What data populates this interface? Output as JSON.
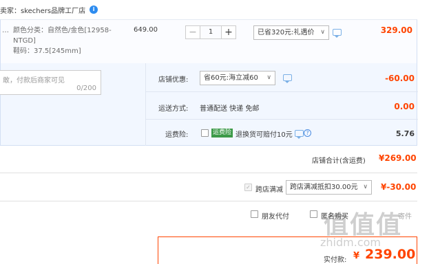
{
  "seller": {
    "label": "卖家：skechers品牌工厂店",
    "badge": "i"
  },
  "item": {
    "dots": "…",
    "sku_color": "颜色分类：自然色/金色[12958-NTGD]",
    "sku_size": "鞋码：37.5[245mm]",
    "unit_price": "649.00",
    "qty_minus": "−",
    "qty": "1",
    "qty_plus": "+",
    "promo_selected": "已省320元:礼遇价",
    "row_total": "329.00"
  },
  "memo": {
    "placeholder": "敢，付款后商家可见",
    "counter": "0/200"
  },
  "shop": {
    "discount_label": "店铺优惠:",
    "discount_selected": "省60元:海立减60",
    "discount_amount": "-60.00",
    "shipping_label": "运送方式:",
    "shipping_value": "普通配送 快递 免邮",
    "shipping_amount": "0.00",
    "insurance_label": "运费险:",
    "insurance_tag": "运费险",
    "insurance_desc": "退换货可赔付10元",
    "insurance_amount": "5.76",
    "total_label": "店铺合计(含运费)",
    "total_amount": "¥269.00"
  },
  "cross": {
    "label": "跨店满减",
    "selected": "跨店满减抵扣30.00元",
    "amount": "¥-30.00"
  },
  "pay": {
    "friend_pay": "朋友代付",
    "anon_pay": "匿名购买",
    "hidden": "寄件"
  },
  "final": {
    "label": "实付款:",
    "currency": "¥",
    "amount": "239.00"
  },
  "watermark": {
    "logo": "值值值",
    "url": "zhidm.com"
  },
  "colors": {
    "accent": "#ff4400",
    "panel": "#f2f7ff",
    "border": "#d3dff3"
  }
}
